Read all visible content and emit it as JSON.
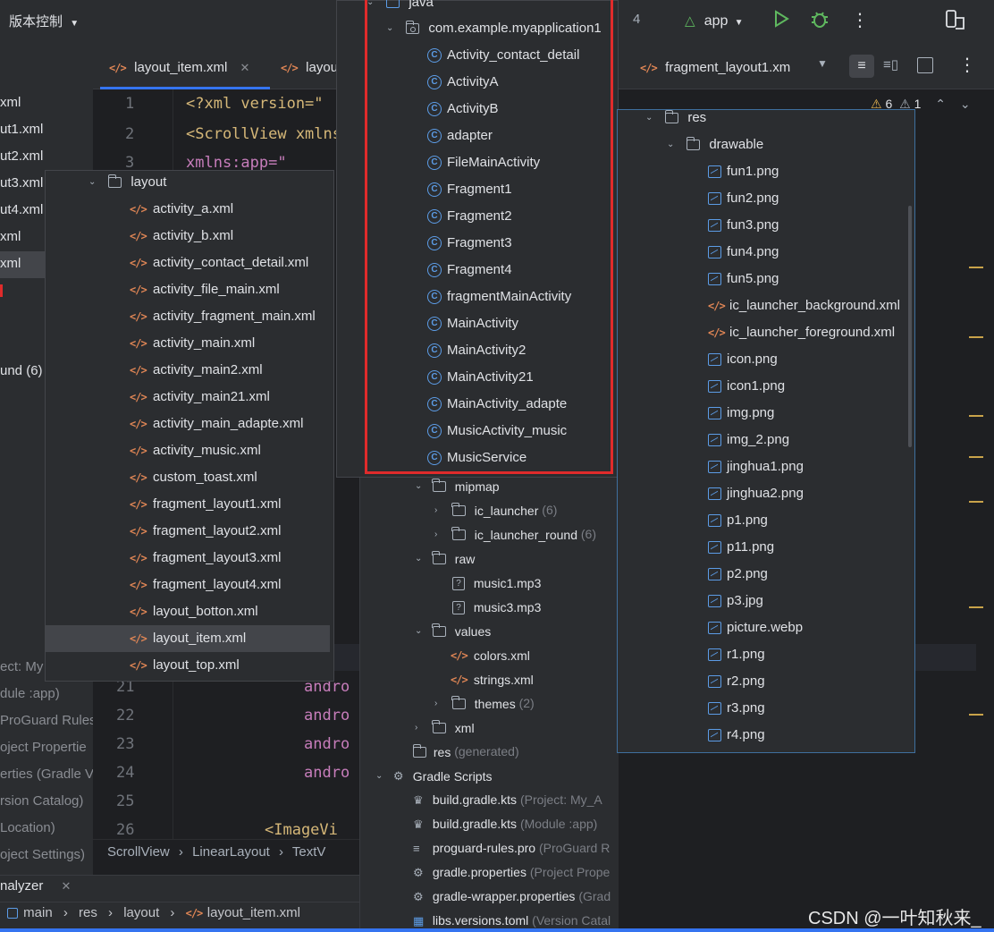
{
  "topbar": {
    "vcs": "版本控制",
    "run_config": "app",
    "digit": "4"
  },
  "tabs": [
    {
      "label": "layout_item.xml"
    },
    {
      "label": "layou"
    },
    {
      "label": "fragment_layout1.xm"
    }
  ],
  "warnings": {
    "warn_count": "6",
    "weak_count": "1"
  },
  "left_partial": [
    "xml",
    "ut1.xml",
    "ut2.xml",
    "ut3.xml",
    "ut4.xml",
    "xml",
    "xml",
    "",
    "",
    "und (6)"
  ],
  "left_bottom": [
    "ect: My",
    "dule :app)",
    "ProGuard Rules",
    "oject Propertie",
    "erties (Gradle V",
    "rsion Catalog)",
    "Location)",
    "oject Settings)"
  ],
  "line_numbers_top": [
    "1",
    "2",
    "3"
  ],
  "line_numbers_bottom": [
    "21",
    "22",
    "23",
    "24",
    "25",
    "26"
  ],
  "code_top": [
    {
      "text": "<?xml version=\""
    },
    {
      "text": "<ScrollView xmlns"
    },
    {
      "text": "    xmlns:app=\""
    }
  ],
  "code_bottom": [
    "andro",
    "andro",
    "andro",
    "andro",
    "",
    "<ImageVi"
  ],
  "layout_popup": {
    "folder": "layout",
    "items": [
      "activity_a.xml",
      "activity_b.xml",
      "activity_contact_detail.xml",
      "activity_file_main.xml",
      "activity_fragment_main.xml",
      "activity_main.xml",
      "activity_main2.xml",
      "activity_main21.xml",
      "activity_main_adapte.xml",
      "activity_music.xml",
      "custom_toast.xml",
      "fragment_layout1.xml",
      "fragment_layout2.xml",
      "fragment_layout3.xml",
      "fragment_layout4.xml",
      "layout_botton.xml",
      "layout_item.xml",
      "layout_top.xml"
    ],
    "selected_index": 16
  },
  "java_popup": {
    "root": "java",
    "package": "com.example.myapplication1",
    "items": [
      "Activity_contact_detail",
      "ActivityA",
      "ActivityB",
      "adapter",
      "FileMainActivity",
      "Fragment1",
      "Fragment2",
      "Fragment3",
      "Fragment4",
      "fragmentMainActivity",
      "MainActivity",
      "MainActivity2",
      "MainActivity21",
      "MainActivity_adapte",
      "MusicActivity_music",
      "MusicService"
    ]
  },
  "res_popup": {
    "root": "res",
    "folder": "drawable",
    "items": [
      {
        "name": "fun1.png",
        "type": "img"
      },
      {
        "name": "fun2.png",
        "type": "img"
      },
      {
        "name": "fun3.png",
        "type": "img"
      },
      {
        "name": "fun4.png",
        "type": "img"
      },
      {
        "name": "fun5.png",
        "type": "img"
      },
      {
        "name": "ic_launcher_background.xml",
        "type": "xml"
      },
      {
        "name": "ic_launcher_foreground.xml",
        "type": "xml"
      },
      {
        "name": "icon.png",
        "type": "img"
      },
      {
        "name": "icon1.png",
        "type": "img"
      },
      {
        "name": "img.png",
        "type": "img"
      },
      {
        "name": "img_2.png",
        "type": "img"
      },
      {
        "name": "jinghua1.png",
        "type": "img"
      },
      {
        "name": "jinghua2.png",
        "type": "img"
      },
      {
        "name": "p1.png",
        "type": "img"
      },
      {
        "name": "p11.png",
        "type": "img"
      },
      {
        "name": "p2.png",
        "type": "img"
      },
      {
        "name": "p3.jpg",
        "type": "img"
      },
      {
        "name": "picture.webp",
        "type": "img"
      },
      {
        "name": "r1.png",
        "type": "img"
      },
      {
        "name": "r2.png",
        "type": "img"
      },
      {
        "name": "r3.png",
        "type": "img"
      },
      {
        "name": "r4.png",
        "type": "img"
      }
    ]
  },
  "tree_bottom": {
    "mipmap": "mipmap",
    "ic_launcher": "ic_launcher",
    "ic_launcher_count": "(6)",
    "ic_launcher_round": "ic_launcher_round",
    "ic_launcher_round_count": "(6)",
    "raw": "raw",
    "music1": "music1.mp3",
    "music3": "music3.mp3",
    "values": "values",
    "colors": "colors.xml",
    "strings": "strings.xml",
    "themes": "themes",
    "themes_count": "(2)",
    "xml": "xml",
    "res": "res",
    "res_note": "(generated)",
    "gradle_scripts": "Gradle Scripts",
    "gradle_files": [
      {
        "name": "build.gradle.kts",
        "note": "(Project: My_A",
        "icon": "gradle"
      },
      {
        "name": "build.gradle.kts",
        "note": "(Module :app)",
        "icon": "gradle"
      },
      {
        "name": "proguard-rules.pro",
        "note": "(ProGuard R",
        "icon": "lines"
      },
      {
        "name": "gradle.properties",
        "note": "(Project Prope",
        "icon": "gear"
      },
      {
        "name": "gradle-wrapper.properties",
        "note": "(Grad",
        "icon": "gear"
      },
      {
        "name": "libs.versions.toml",
        "note": "(Version Catal",
        "icon": "toml"
      }
    ]
  },
  "breadcrumb_code": [
    "ScrollView",
    "LinearLayout",
    "TextV"
  ],
  "bottom_tool": "nalyzer",
  "status_path": [
    "main",
    "res",
    "layout",
    "layout_item.xml"
  ],
  "watermark": "CSDN @一叶知秋来_",
  "colors": {
    "accent": "#3574f0",
    "highlight_red": "#e02b2b",
    "xml_orange": "#e08655",
    "class_blue": "#5c9ce6"
  }
}
